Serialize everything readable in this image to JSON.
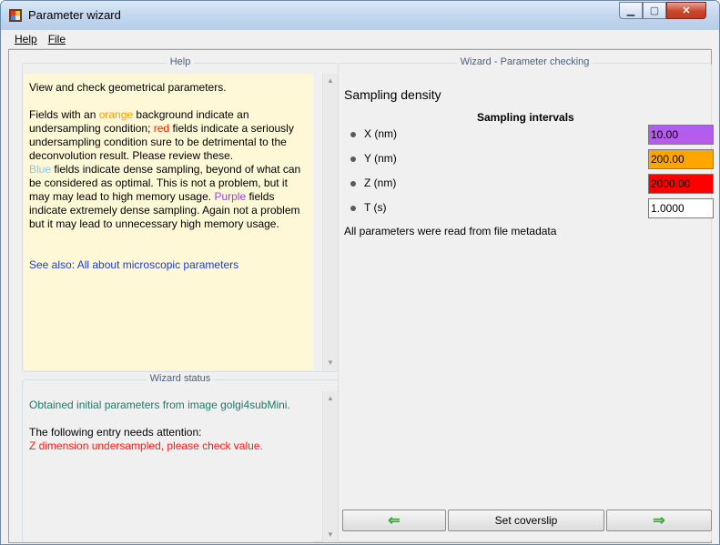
{
  "window": {
    "title": "Parameter wizard"
  },
  "menu": {
    "help": "Help",
    "file": "File"
  },
  "help_panel": {
    "title": "Help",
    "p1": "View and check geometrical parameters.",
    "p2a": "Fields with an ",
    "orange_word": "orange",
    "p2b": "  background indicate an undersampling condition;  ",
    "red_word": "red",
    "p2c": " fields indicate a seriously undersampling condition sure to be detrimental to the deconvolution result. Please review these.",
    "blue_word": "Blue",
    "p3a": " fields indicate dense sampling, beyond of what can be considered  as optimal. This is not a problem, but it may may lead to high memory usage. ",
    "purple_word": "Purple",
    "p3b": "  fields indicate extremely dense sampling. Again not a problem  but it may lead to unnecessary high memory usage.",
    "see_also": "See also: All about microscopic parameters"
  },
  "status_panel": {
    "title": "Wizard status",
    "line1": "Obtained initial parameters from image golgi4subMini.",
    "line2": "The following entry needs attention:",
    "line3": "Z dimension undersampled, please check value."
  },
  "wizard_panel": {
    "title": "Wizard - Parameter checking",
    "section": "Sampling density",
    "intervals_title": "Sampling intervals",
    "params": [
      {
        "label": "X (nm)",
        "value": "10.00",
        "color": "#b45ced"
      },
      {
        "label": "Y (nm)",
        "value": "200.00",
        "color": "#ffa500"
      },
      {
        "label": "Z (nm)",
        "value": "2000.00",
        "color": "#ff0000"
      },
      {
        "label": "T (s)",
        "value": "1.0000",
        "color": "#ffffff"
      }
    ],
    "note": "All parameters were read from file metadata",
    "back_icon": "arrow-left-icon",
    "middle_button": "Set coverslip",
    "next_icon": "arrow-right-icon"
  },
  "colors": {
    "orange_text": "#ff9a00",
    "red_text": "#ff2000",
    "blue_text": "#80c8ff",
    "purple_text": "#a040e0",
    "link": "#1c3dd6",
    "status_green": "#1f7a6a",
    "status_red": "#ff1a1a"
  }
}
